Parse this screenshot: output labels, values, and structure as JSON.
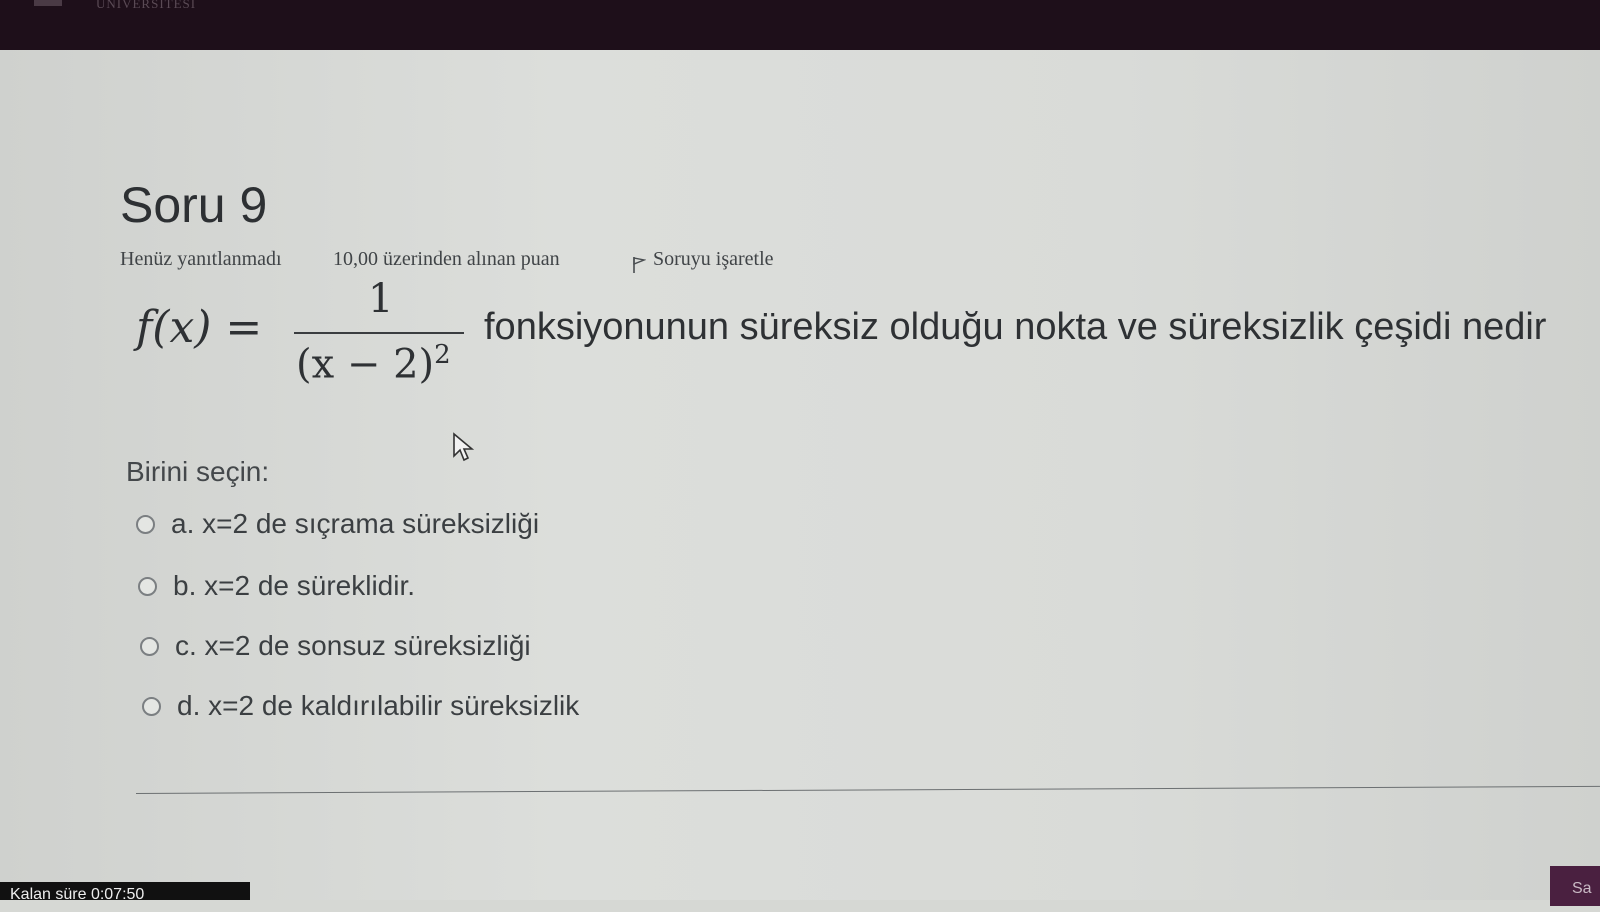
{
  "header": {
    "brand": "ÜNİVERSİTESİ"
  },
  "question": {
    "title": "Soru 9",
    "status": "Henüz yanıtlanmadı",
    "grade": "10,00 üzerinden alınan puan",
    "flag_label": "Soruyu işaretle",
    "formula": {
      "lhs": "f(x) =",
      "numerator": "1",
      "denominator_base": "(x − 2)",
      "denominator_exponent": "2"
    },
    "text": "fonksiyonunun süreksiz olduğu nokta ve süreksizlik çeşidi nedir",
    "choose_label": "Birini seçin:",
    "options": [
      "a. x=2 de sıçrama süreksizliği",
      "b. x=2 de süreklidir.",
      "c. x=2 de sonsuz süreksizliği",
      "d. x=2 de kaldırılabilir süreksizlik"
    ]
  },
  "footer": {
    "timer": "Kalan süre 0:07:50",
    "next_label": "Sa"
  }
}
